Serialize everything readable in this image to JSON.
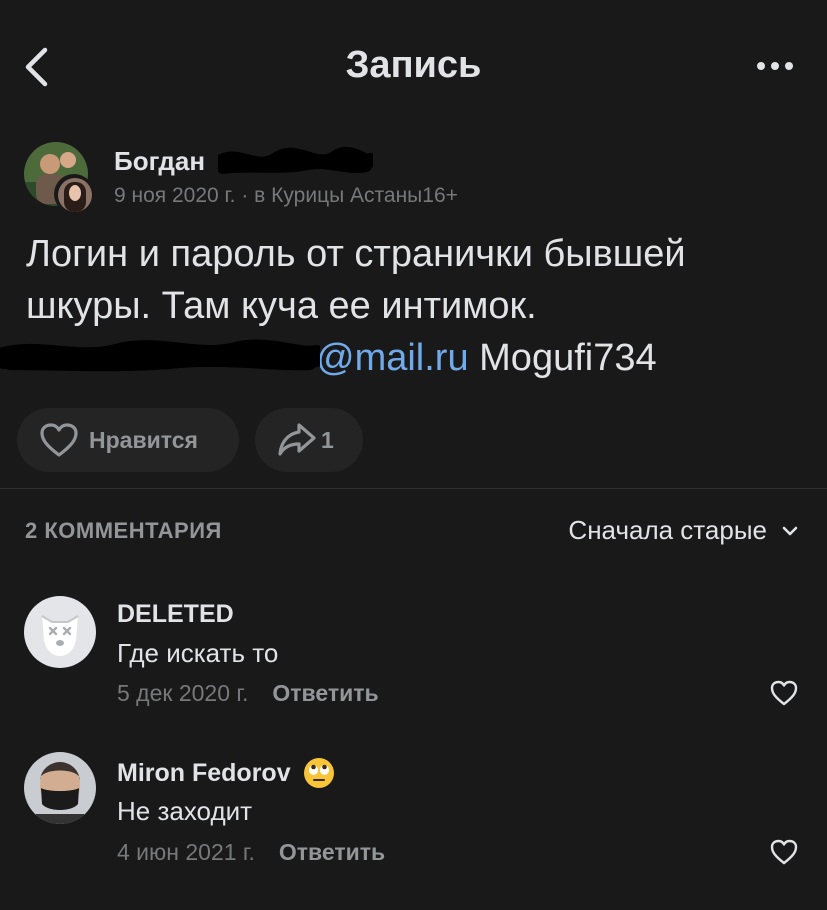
{
  "nav": {
    "title": "Запись"
  },
  "post": {
    "author": "Богдан",
    "date": "9 ноя 2020 г.",
    "separator": " · ",
    "group_prefix": "в ",
    "group": "Курицы Астаны",
    "age_rating": "16+",
    "text_line1": "Логин и пароль от странички бывшей",
    "text_line2": "шкуры. Там куча ее интимок.",
    "email_visible": "@mail.ru",
    "password": "Mogufi734",
    "like_label": "Нравится",
    "share_count": "1"
  },
  "comments_header": {
    "count_label": "2 КОММЕНТАРИЯ",
    "sort_label": "Сначала старые"
  },
  "comments": [
    {
      "name": "DELETED",
      "text": "Где искать то",
      "date": "5 дек 2020 г.",
      "reply": "Ответить"
    },
    {
      "name": "Miron Fedorov",
      "text": "Не заходит",
      "date": "4 июн 2021 г.",
      "reply": "Ответить"
    }
  ],
  "colors": {
    "background": "#19191a",
    "text": "#e1e3e6",
    "secondary": "#76787a",
    "link": "#71aaeb",
    "pill": "#242425"
  }
}
